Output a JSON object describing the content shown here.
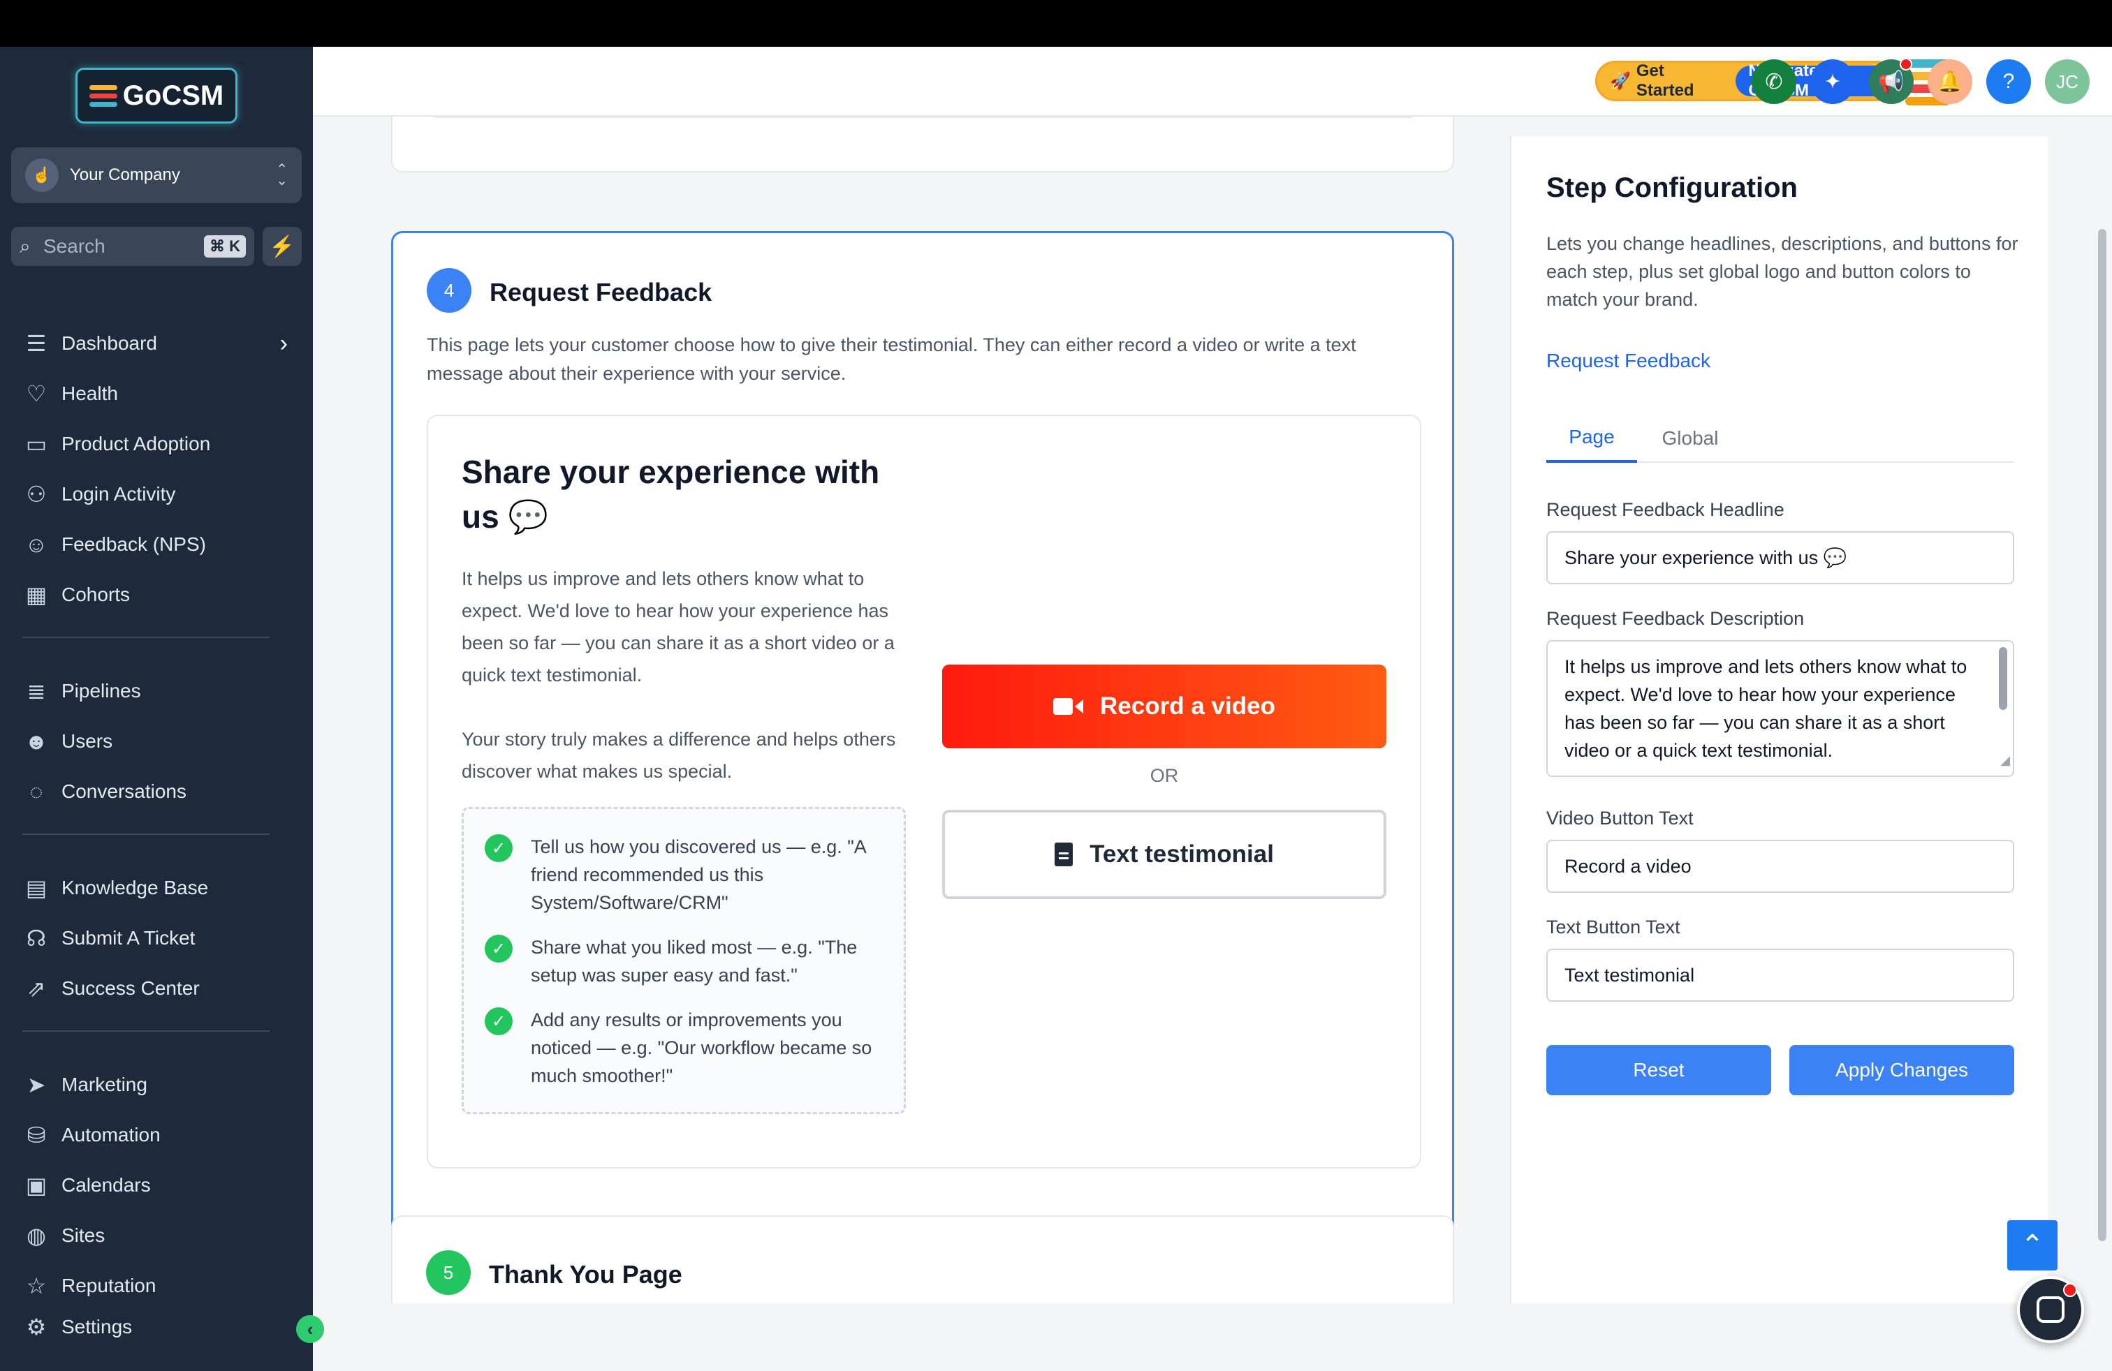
{
  "brand": {
    "name": "GoCSM",
    "colors": {
      "sidebar": "#1e2a3b",
      "primary": "#1d63ed",
      "success": "#22c55e",
      "record": "#ff3a10"
    }
  },
  "sidebar": {
    "company": "Your Company",
    "search_placeholder": "Search",
    "search_shortcut": "⌘ K",
    "groups": [
      [
        {
          "label": "Dashboard",
          "icon": "dashboard-icon",
          "chevron": true
        },
        {
          "label": "Health",
          "icon": "heart-pulse-icon"
        },
        {
          "label": "Product Adoption",
          "icon": "laptop-icon"
        },
        {
          "label": "Login Activity",
          "icon": "user-login-icon"
        },
        {
          "label": "Feedback (NPS)",
          "icon": "feedback-icon"
        },
        {
          "label": "Cohorts",
          "icon": "table-icon"
        }
      ],
      [
        {
          "label": "Pipelines",
          "icon": "pipelines-icon"
        },
        {
          "label": "Users",
          "icon": "users-icon"
        },
        {
          "label": "Conversations",
          "icon": "chat-bubble-icon"
        }
      ],
      [
        {
          "label": "Knowledge Base",
          "icon": "knowledge-base-icon"
        },
        {
          "label": "Submit A Ticket",
          "icon": "headset-icon"
        },
        {
          "label": "Success Center",
          "icon": "success-chart-icon"
        }
      ],
      [
        {
          "label": "Marketing",
          "icon": "paper-plane-icon"
        },
        {
          "label": "Automation",
          "icon": "automation-icon"
        },
        {
          "label": "Calendars",
          "icon": "calendar-icon"
        },
        {
          "label": "Sites",
          "icon": "globe-icon"
        },
        {
          "label": "Reputation",
          "icon": "star-icon"
        }
      ]
    ],
    "settings": "Settings"
  },
  "header": {
    "get_started": "Get Started",
    "navigate": "Navigate GoCSM",
    "avatar_initials": "JC",
    "help": "?"
  },
  "step4": {
    "number": "4",
    "title": "Request Feedback",
    "description": "This page lets your customer choose how to give their testimonial. They can either record a video or write a text message about their experience with your service.",
    "preview": {
      "headline": "Share your experience with us 💬",
      "body": "It helps us improve and lets others know what to expect. We'd love to hear how your experience has been so far — you can share it as a short video or a quick text testimonial.",
      "story": "Your story truly makes a difference and helps others discover what makes us special.",
      "tips": [
        "Tell us how you discovered us — e.g. \"A friend recommended us this System/Software/CRM\"",
        "Share what you liked most — e.g. \"The setup was super easy and fast.\"",
        "Add any results or improvements you noticed — e.g. \"Our workflow became so much smoother!\""
      ],
      "video_button": "Record a video",
      "or": "OR",
      "text_button": "Text testimonial"
    }
  },
  "step5": {
    "number": "5",
    "title": "Thank You Page"
  },
  "config": {
    "title": "Step Configuration",
    "description": "Lets you change headlines, descriptions, and buttons for each step, plus set global logo and button colors to match your brand.",
    "current_step": "Request Feedback",
    "tabs": [
      "Page",
      "Global"
    ],
    "fields": {
      "headline_label": "Request Feedback Headline",
      "headline_value": "Share your experience with us 💬",
      "description_label": "Request Feedback Description",
      "description_value": "It helps us improve and lets others know what to expect. We'd love to hear how your experience has been so far — you can share it as a short video or a quick text testimonial.",
      "video_label": "Video Button Text",
      "video_value": "Record a video",
      "text_label": "Text Button Text",
      "text_value": "Text testimonial"
    },
    "reset": "Reset",
    "apply": "Apply Changes"
  }
}
